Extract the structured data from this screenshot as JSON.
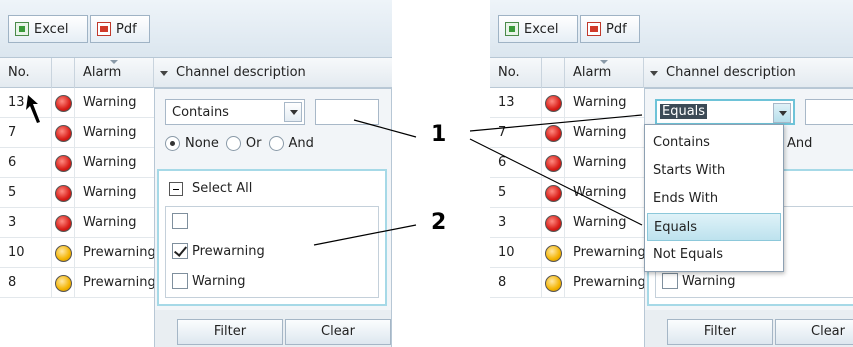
{
  "toolbar": {
    "excel_label": "Excel",
    "pdf_label": "Pdf"
  },
  "grid": {
    "headers": {
      "no": "No.",
      "alarm": "Alarm",
      "channel": "Channel description"
    },
    "rows_left": [
      {
        "no": "13",
        "alarm": "Warning",
        "level": "red"
      },
      {
        "no": "7",
        "alarm": "Warning",
        "level": "red"
      },
      {
        "no": "6",
        "alarm": "Warning",
        "level": "red"
      },
      {
        "no": "5",
        "alarm": "Warning",
        "level": "red"
      },
      {
        "no": "3",
        "alarm": "Warning",
        "level": "red"
      },
      {
        "no": "10",
        "alarm": "Prewarning",
        "level": "yellow"
      },
      {
        "no": "8",
        "alarm": "Prewarning",
        "level": "yellow"
      }
    ]
  },
  "filter_left": {
    "operator": "Contains",
    "value": "",
    "radio_labels": [
      "None",
      "Or",
      "And"
    ],
    "selected_radio": "None",
    "select_all_label": "Select All",
    "items": [
      {
        "label": "",
        "checked": false
      },
      {
        "label": "Prewarning",
        "checked": true
      },
      {
        "label": "Warning",
        "checked": false
      }
    ],
    "filter_label": "Filter",
    "clear_label": "Clear"
  },
  "filter_right": {
    "operator": "Equals",
    "radio_partial": "And",
    "options": [
      "Contains",
      "Starts With",
      "Ends With",
      "Equals",
      "Not Equals"
    ],
    "highlighted_option": "Equals",
    "item_visible": "Warning",
    "filter_label": "Filter",
    "clear_label": "Clear"
  },
  "callouts": {
    "one": "1",
    "two": "2"
  },
  "colors": {
    "warning": "#d91e18",
    "prewarning": "#f4b400",
    "focus": "#6ec3d8"
  }
}
